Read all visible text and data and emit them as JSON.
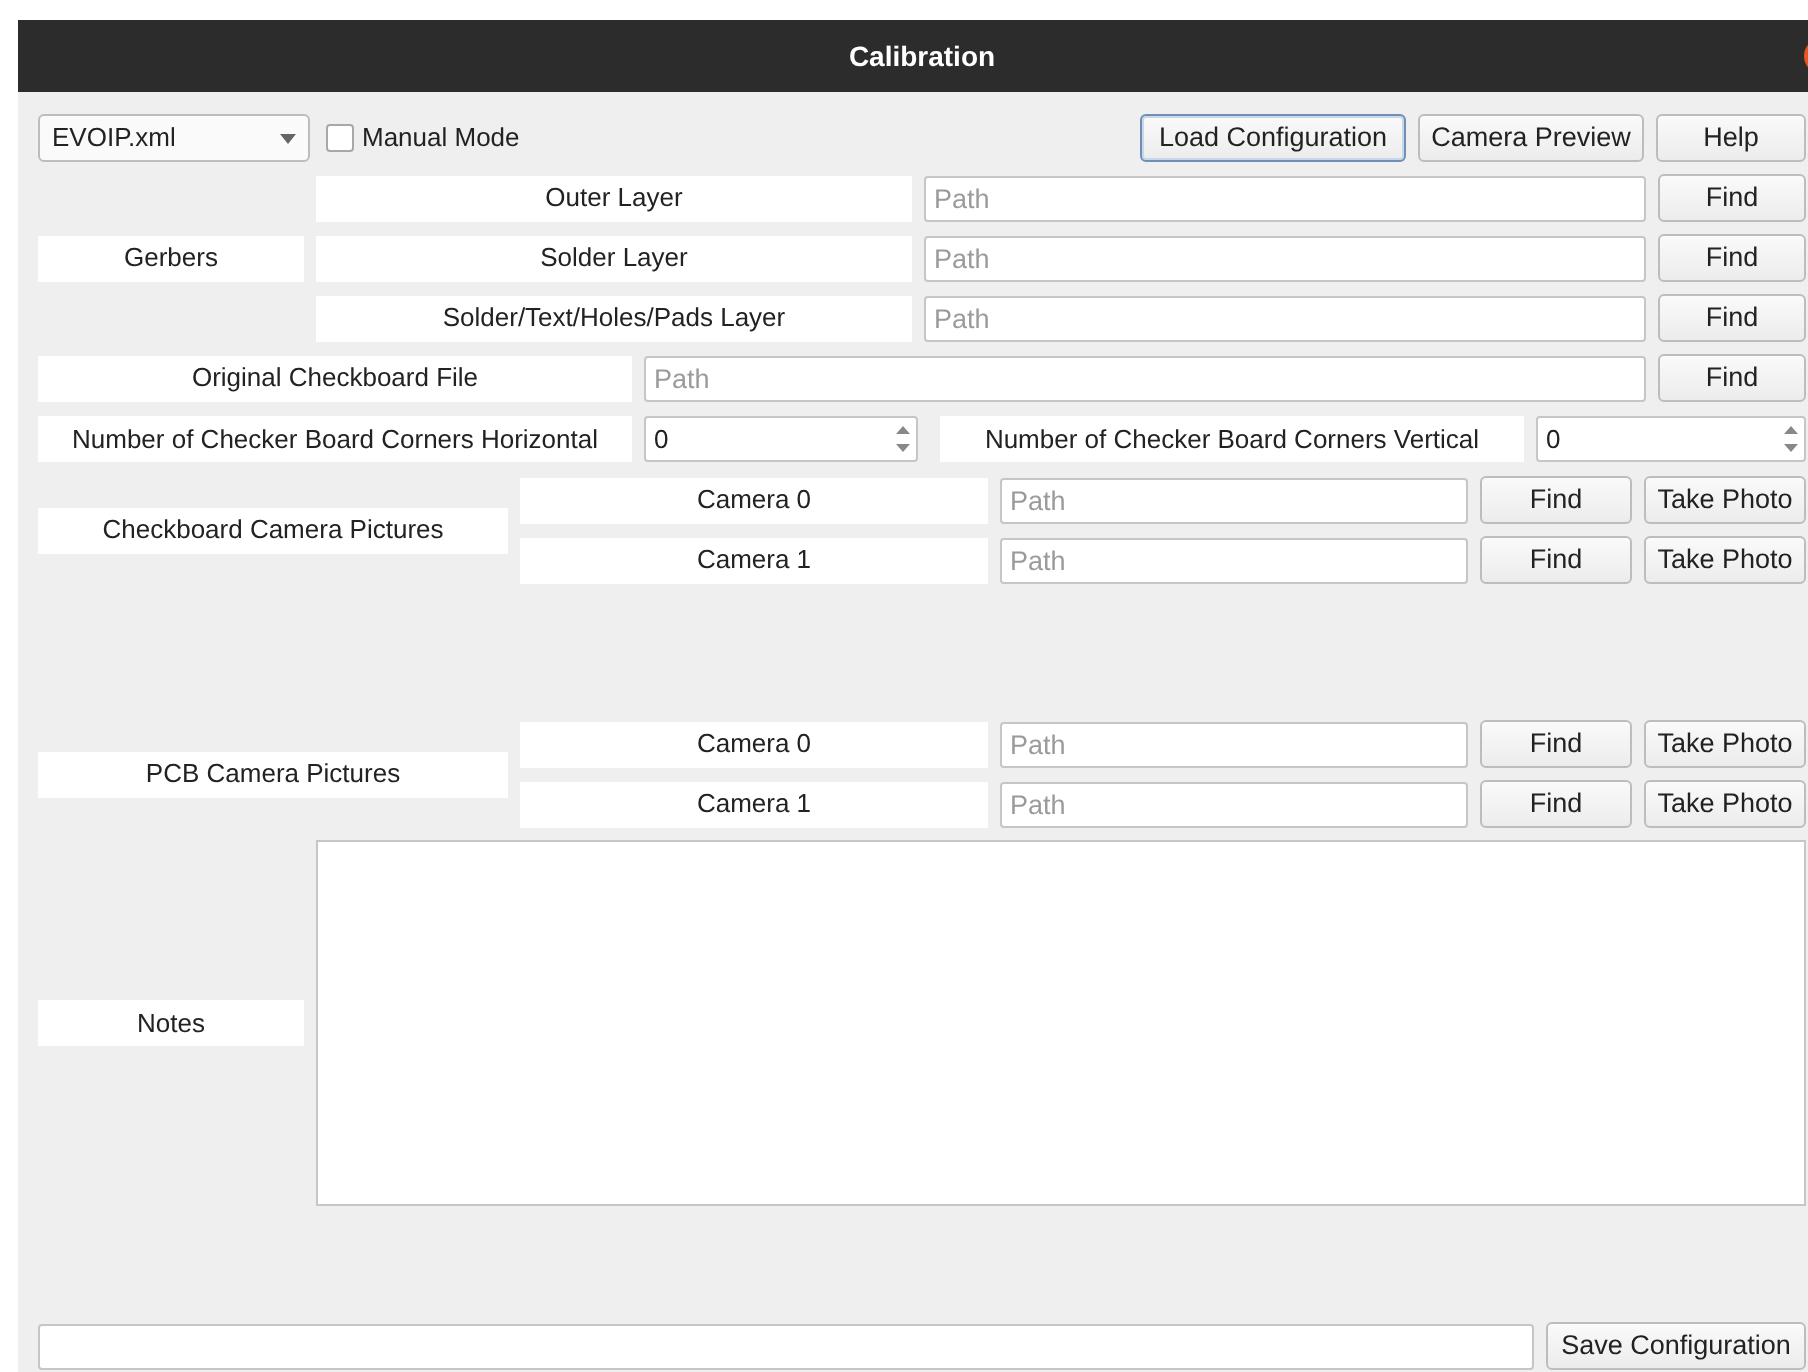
{
  "window": {
    "title": "Calibration"
  },
  "toolbar": {
    "config_select": {
      "value": "EVOIP.xml"
    },
    "manual_mode": {
      "label": "Manual Mode",
      "checked": false
    },
    "buttons": [
      {
        "label": "Load Configuration",
        "focused": true
      },
      {
        "label": "Camera Preview",
        "focused": false
      },
      {
        "label": "Help",
        "focused": false
      }
    ]
  },
  "gerbers": {
    "label": "Gerbers",
    "layers": [
      {
        "label": "Outer Layer",
        "placeholder": "Path",
        "button": "Find"
      },
      {
        "label": "Solder Layer",
        "placeholder": "Path",
        "button": "Find"
      },
      {
        "label": "Solder/Text/Holes/Pads Layer",
        "placeholder": "Path",
        "button": "Find"
      }
    ]
  },
  "checkboard_file": {
    "label": "Original Checkboard File",
    "placeholder": "Path",
    "button": "Find"
  },
  "corners": [
    {
      "label": "Number of Checker Board Corners Horizontal",
      "value": "0"
    },
    {
      "label": "Number of Checker Board Corners Vertical",
      "value": "0"
    }
  ],
  "camera_groups": [
    {
      "label": "Checkboard Camera Pictures",
      "cameras": [
        {
          "label": "Camera 0",
          "placeholder": "Path",
          "buttons": [
            "Find",
            "Take Photo"
          ]
        },
        {
          "label": "Camera 1",
          "placeholder": "Path",
          "buttons": [
            "Find",
            "Take Photo"
          ]
        }
      ]
    },
    {
      "label": "PCB Camera Pictures",
      "cameras": [
        {
          "label": "Camera 0",
          "placeholder": "Path",
          "buttons": [
            "Find",
            "Take Photo"
          ]
        },
        {
          "label": "Camera 1",
          "placeholder": "Path",
          "buttons": [
            "Find",
            "Take Photo"
          ]
        }
      ]
    }
  ],
  "notes": {
    "label": "Notes"
  },
  "footer": {
    "button": "Save Configuration"
  }
}
